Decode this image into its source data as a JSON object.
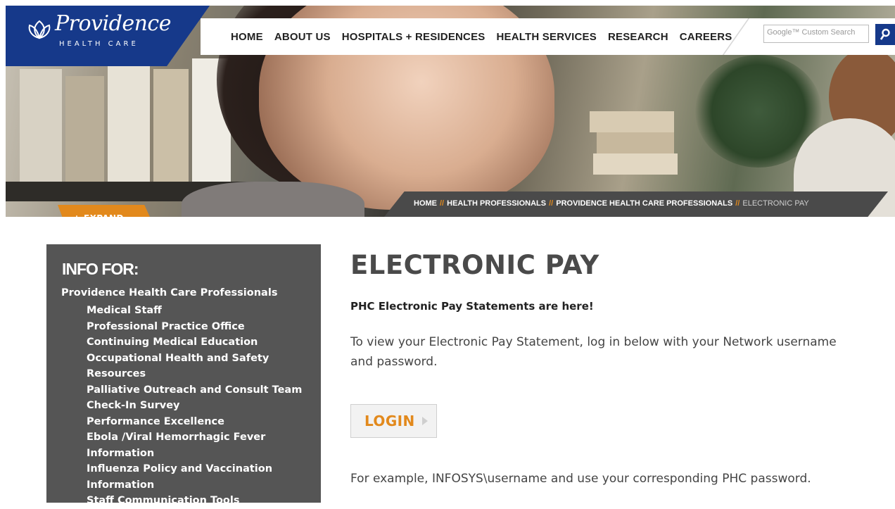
{
  "header": {
    "logo": {
      "name": "Providence",
      "sub": "HEALTH CARE"
    },
    "nav": [
      "HOME",
      "ABOUT US",
      "HOSPITALS + RESIDENCES",
      "HEALTH SERVICES",
      "RESEARCH",
      "CAREERS"
    ],
    "search": {
      "placeholder": "Google™ Custom Search",
      "icon": "search-icon"
    }
  },
  "breadcrumb": {
    "items": [
      "HOME",
      "HEALTH PROFESSIONALS",
      "PROVIDENCE HEALTH CARE PROFESSIONALS"
    ],
    "current": "ELECTRONIC PAY",
    "separator": "//"
  },
  "expand_label": "+ EXPAND",
  "sidebar": {
    "title": "INFO FOR:",
    "top_link": "Providence Health Care Professionals",
    "items": [
      "Medical Staff",
      "Professional Practice Office",
      "Continuing Medical Education",
      "Occupational Health and Safety Resources",
      "Palliative Outreach and Consult Team",
      "Check-In Survey",
      "Performance Excellence",
      "Ebola /Viral Hemorrhagic Fever Information",
      "Influenza Policy and Vaccination Information",
      "Staff Communication Tools"
    ]
  },
  "main": {
    "title": "ELECTRONIC PAY",
    "subtitle": "PHC Electronic Pay Statements are here!",
    "description": "To view your Electronic Pay Statement, log in below with your Network username and password.",
    "login_label": "LOGIN",
    "example": "For example, INFOSYS\\username and use your corresponding PHC password."
  },
  "colors": {
    "brand_blue": "#16398a",
    "accent_orange": "#e2891c",
    "sidebar_gray": "#555555",
    "breadcrumb_bg": "#4a4a4a"
  }
}
